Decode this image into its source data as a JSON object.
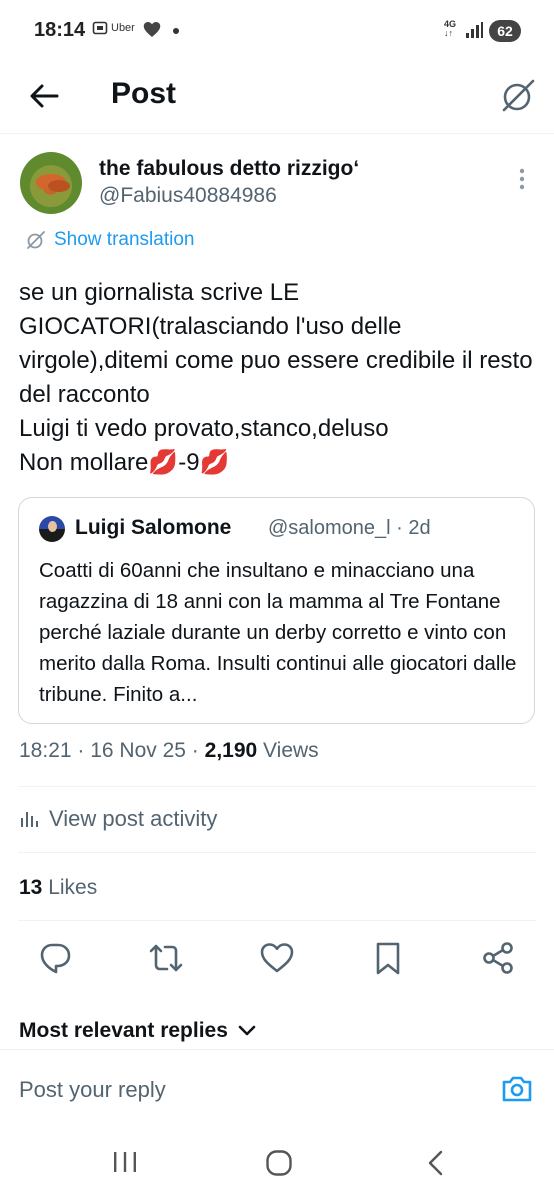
{
  "status_bar": {
    "time": "18:14",
    "uber_label": "Uber",
    "network": "4G",
    "battery": "62"
  },
  "header": {
    "title": "Post"
  },
  "post": {
    "author_name": "the fabulous detto rizzigo‘",
    "author_handle": "@Fabius40884986",
    "translation_label": "Show translation",
    "text": "se un giornalista scrive LE GIOCATORI(tralasciando l'uso delle virgole),ditemi come puo essere credibile il resto del racconto\nLuigi ti vedo provato,stanco,deluso\nNon mollare💋-9💋",
    "time": "18:21",
    "date": "16 Nov 25",
    "views_count": "2,190",
    "views_label": "Views",
    "activity_label": "View post activity",
    "likes_count": "13",
    "likes_label": "Likes"
  },
  "quote": {
    "name": "Luigi Salomone",
    "handle": "@salomone_l · 2d",
    "text": "Coatti di 60anni che insultano e minacciano una ragazzina di 18 anni con la mamma  al Tre Fontane perché laziale durante un derby corretto e vinto con merito dalla Roma. Insulti continui alle giocatori dalle tribune. Finito a..."
  },
  "replies": {
    "sort_label": "Most relevant replies",
    "placeholder": "Post your reply"
  },
  "colors": {
    "accent": "#1d9bf0",
    "secondary_text": "#536471",
    "primary_text": "#0f1419",
    "border": "#cfd9de"
  },
  "icons": [
    "back-arrow-icon",
    "grok-icon",
    "more-vertical-icon",
    "translate-icon",
    "stats-icon",
    "reply-icon",
    "repost-icon",
    "like-icon",
    "bookmark-icon",
    "share-icon",
    "chevron-down-icon",
    "camera-icon"
  ]
}
